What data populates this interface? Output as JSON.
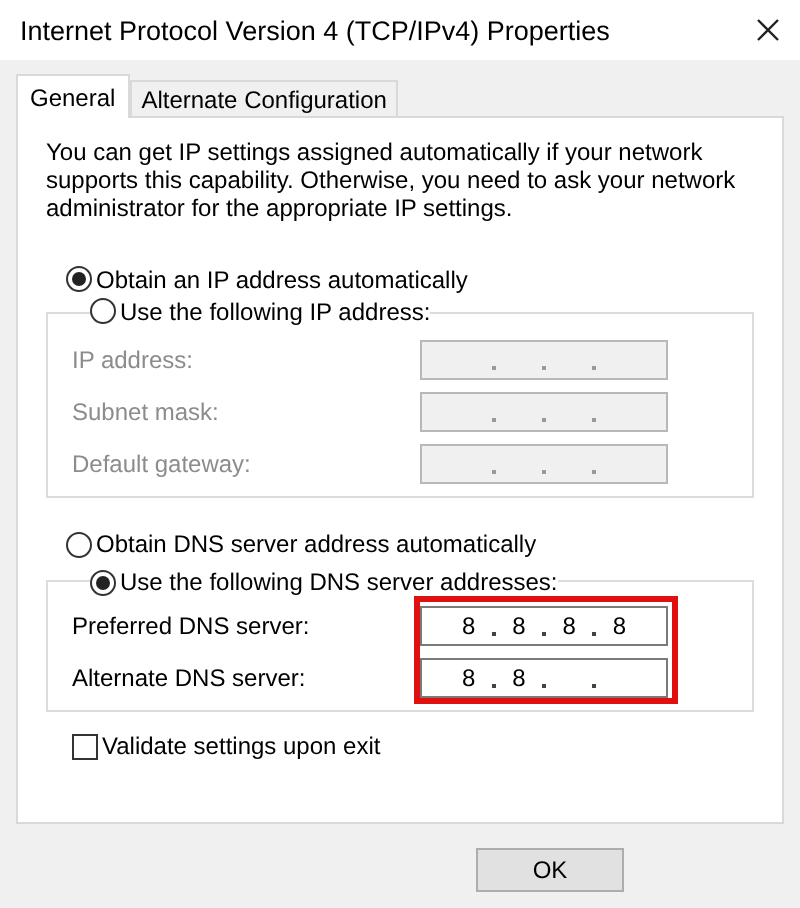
{
  "window": {
    "title": "Internet Protocol Version 4 (TCP/IPv4) Properties"
  },
  "tabs": [
    {
      "label": "General",
      "selected": true
    },
    {
      "label": "Alternate Configuration",
      "selected": false
    }
  ],
  "intro": "You can get IP settings assigned automatically if your network supports this capability. Otherwise, you need to ask your network administrator for the appropriate IP settings.",
  "ip_mode": [
    {
      "label": "Obtain an IP address automatically",
      "selected": true
    },
    {
      "label": "Use the following IP address:",
      "selected": false
    }
  ],
  "ip_fields": [
    {
      "label": "IP address:",
      "disabled": true
    },
    {
      "label": "Subnet mask:",
      "disabled": true
    },
    {
      "label": "Default gateway:",
      "disabled": true
    }
  ],
  "dns_mode": [
    {
      "label": "Obtain DNS server address automatically",
      "selected": false
    },
    {
      "label": "Use the following DNS server addresses:",
      "selected": true
    }
  ],
  "dns_fields": [
    {
      "label": "Preferred DNS server:",
      "disabled": false,
      "octets": [
        "8",
        "8",
        "8",
        "8"
      ]
    },
    {
      "label": "Alternate DNS server:",
      "disabled": false,
      "octets": [
        "8",
        "8"
      ]
    }
  ],
  "dns_highlighted": true,
  "validate": {
    "label": "Validate settings upon exit",
    "checked": false
  },
  "buttons": [
    "OK"
  ]
}
